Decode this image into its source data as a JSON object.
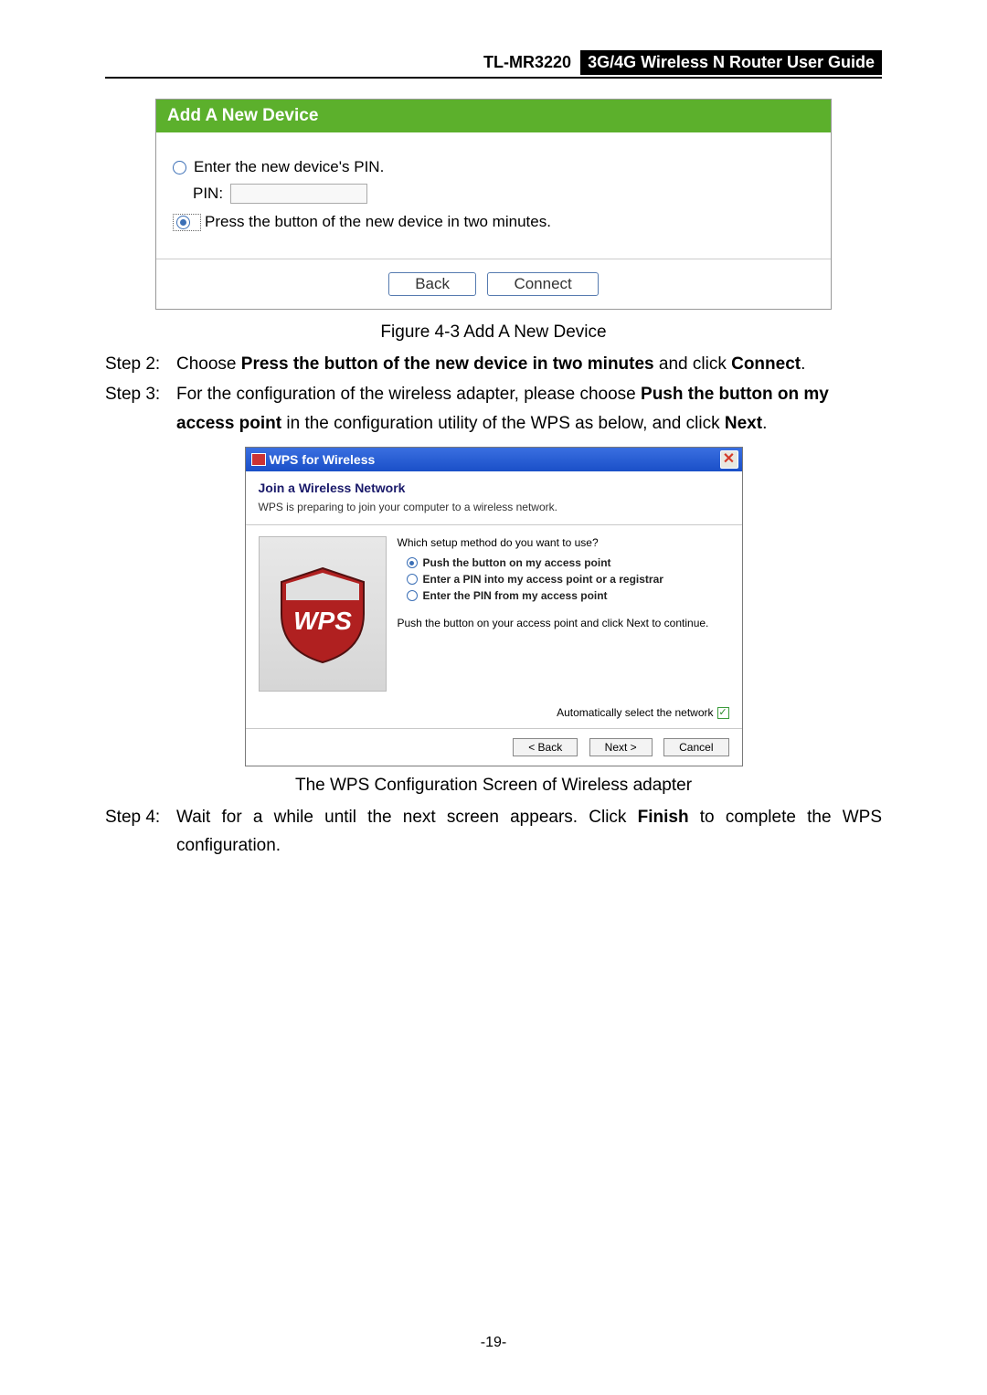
{
  "header": {
    "model": "TL-MR3220",
    "title": "3G/4G Wireless N Router User Guide"
  },
  "addDevice": {
    "header": "Add A New Device",
    "option1": "Enter the new device's PIN.",
    "pinLabel": "PIN:",
    "option2": "Press the button of the new device in two minutes.",
    "backBtn": "Back",
    "connectBtn": "Connect"
  },
  "figureCaption": "Figure 4-3    Add A New Device",
  "step2": {
    "label": "Step 2:",
    "pre": "Choose ",
    "bold1": "Press the button of the new device in two minutes",
    "mid": " and click ",
    "bold2": "Connect",
    "post": "."
  },
  "step3": {
    "label": "Step 3:",
    "pre": "For the configuration of the wireless adapter, please choose ",
    "bold1": "Push the button on my access point",
    "mid": " in the configuration utility of the WPS as below, and click ",
    "bold2": "Next",
    "post": "."
  },
  "wps": {
    "title": "WPS for Wireless",
    "joinTitle": "Join a Wireless Network",
    "subText": "WPS is preparing to join your computer to a wireless network.",
    "question": "Which setup method do you want to use?",
    "opt1": "Push the button on my access point",
    "opt2": "Enter a PIN into my access point or a registrar",
    "opt3": "Enter the PIN from my access point",
    "instruct": "Push the button on your access point and click Next to continue.",
    "autoLabel": "Automatically select the network",
    "backBtn": "< Back",
    "nextBtn": "Next >",
    "cancelBtn": "Cancel",
    "badgeText": "WPS"
  },
  "caption2": "The WPS Configuration Screen of Wireless adapter",
  "step4": {
    "label": "Step 4:",
    "pre": "Wait for a while until the next screen appears. Click ",
    "bold1": "Finish",
    "post": " to complete the WPS configuration."
  },
  "pageNumber": "-19-"
}
